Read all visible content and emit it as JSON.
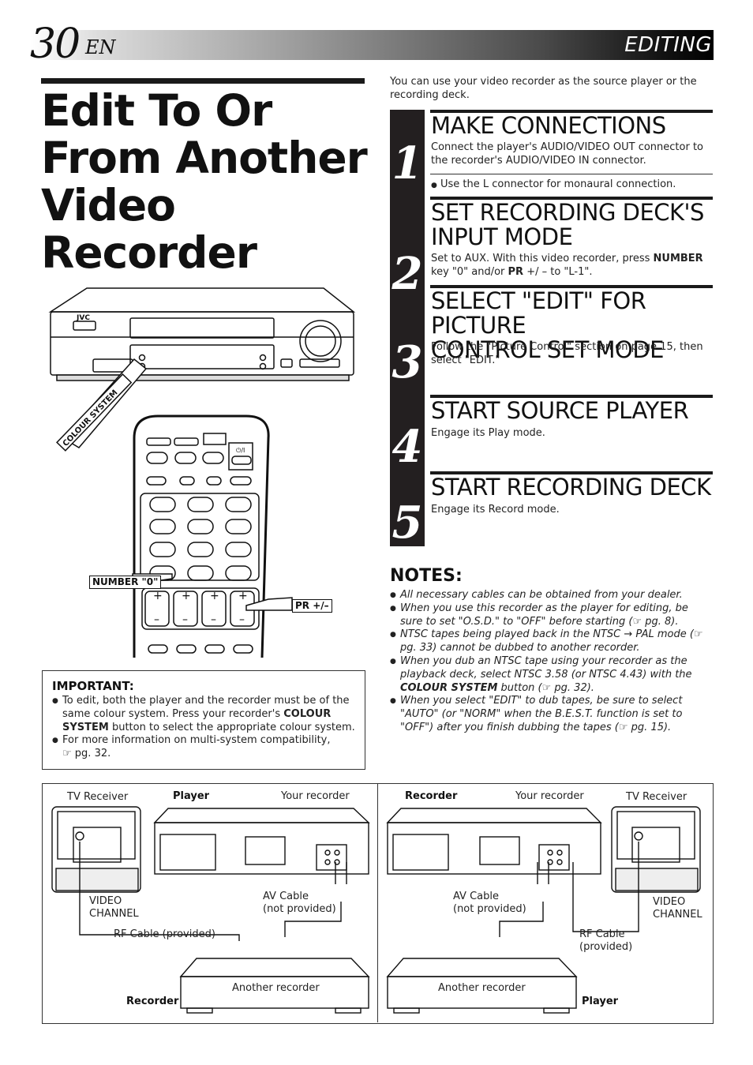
{
  "header": {
    "page_number": "30",
    "language": "EN",
    "section": "EDITING"
  },
  "title": {
    "lines": [
      "Edit To Or",
      "From Another",
      "Video",
      "Recorder"
    ]
  },
  "intro": "You can use your video recorder as the source player or the recording deck.",
  "steps": [
    {
      "number": "1",
      "title_lines": [
        "MAKE CONNECTIONS"
      ],
      "body": "Connect the player's AUDIO/VIDEO OUT connector to the recorder's AUDIO/VIDEO IN connector.",
      "note": "Use the L connector for monaural connection."
    },
    {
      "number": "2",
      "title_lines": [
        "SET RECORDING DECK'S",
        "INPUT MODE"
      ],
      "body_parts": [
        "Set to AUX. With this video recorder, press ",
        "NUMBER",
        " key \"0\" and/or ",
        "PR",
        " +/ – to \"L-1\"."
      ]
    },
    {
      "number": "3",
      "title_lines": [
        "SELECT \"EDIT\" FOR PICTURE",
        "CONTROL SET MODE"
      ],
      "body": "Follow the \"Picture Control\" section on page 15, then select \"EDIT.\""
    },
    {
      "number": "4",
      "title_lines": [
        "START SOURCE PLAYER"
      ],
      "body": "Engage its Play mode."
    },
    {
      "number": "5",
      "title_lines": [
        "START RECORDING DECK"
      ],
      "body": "Engage its Record mode."
    }
  ],
  "notes": {
    "heading": "NOTES:",
    "ref_icon": "☞",
    "items": [
      {
        "text": "All necessary cables can be obtained from your dealer."
      },
      {
        "pre": "When you use this recorder as the player for editing, be sure to set \"O.S.D.\" to  \"OFF\" before starting (",
        "ref": "pg. 8)."
      },
      {
        "pre": "NTSC tapes being played back in the NTSC ",
        "arrow": "→",
        "mid": " PAL mode (",
        "ref": "pg. 33) cannot be dubbed to another recorder."
      },
      {
        "pre": "When you dub an NTSC tape using your recorder as the playback deck, select NTSC 3.58 (or NTSC 4.43) with the ",
        "bold": "COLOUR SYSTEM",
        "mid": " button (",
        "ref": "pg. 32)."
      },
      {
        "pre": "When you select \"EDIT\" to dub tapes, be sure to select \"AUTO\" (or \"NORM\" when the B.E.S.T. function is set to \"OFF\") after you finish dubbing the tapes (",
        "ref": "pg. 15)."
      }
    ]
  },
  "important": {
    "heading": "IMPORTANT:",
    "item1_parts": [
      "To edit, both the player and the recorder must be of the same colour system. Press your recorder's ",
      "COLOUR SYSTEM",
      " button to select the appropriate colour system."
    ],
    "item2_pre": "For more information on multi-system compatibility,",
    "item2_ref": "pg. 32."
  },
  "illustration": {
    "vcr_brand": "JVC",
    "colour_system_label": "COLOUR SYSTEM",
    "number_label": "NUMBER \"0\"",
    "pr_label": "PR +/–",
    "power_label": "⏻/I"
  },
  "diagram_left": {
    "tv": "TV Receiver",
    "role_top": "Player",
    "your_recorder": "Your recorder",
    "video_channel_1": "VIDEO",
    "video_channel_2": "CHANNEL",
    "av_cable_1": "AV Cable",
    "av_cable_2": "(not provided)",
    "rf_cable": "RF Cable (provided)",
    "another": "Another recorder",
    "role_bottom": "Recorder"
  },
  "diagram_right": {
    "role_top": "Recorder",
    "your_recorder": "Your recorder",
    "tv": "TV Receiver",
    "av_cable_1": "AV Cable",
    "av_cable_2": "(not provided)",
    "video_channel_1": "VIDEO",
    "video_channel_2": "CHANNEL",
    "rf_cable_1": "RF Cable",
    "rf_cable_2": "(provided)",
    "another": "Another recorder",
    "role_bottom": "Player"
  }
}
